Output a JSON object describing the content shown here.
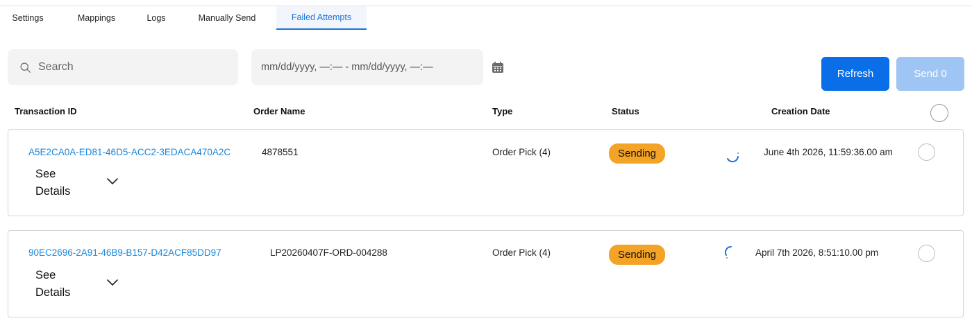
{
  "tabs": [
    {
      "label": "Settings"
    },
    {
      "label": "Mappings"
    },
    {
      "label": "Logs"
    },
    {
      "label": "Manually Send"
    },
    {
      "label": "Failed Attempts",
      "active": true
    }
  ],
  "search": {
    "placeholder": "Search",
    "icon": "search-icon"
  },
  "date_range": {
    "text": "mm/dd/yyyy, —:—  - mm/dd/yyyy, —:—",
    "icon": "calendar-icon"
  },
  "buttons": {
    "refresh": "Refresh",
    "send": "Send 0"
  },
  "table": {
    "headers": {
      "transaction_id": "Transaction ID",
      "order_name": "Order Name",
      "type": "Type",
      "status": "Status",
      "creation_date": "Creation Date"
    },
    "rows": [
      {
        "transaction_id": "A5E2CA0A-ED81-46D5-ACC2-3EDACA470A2C",
        "see_details_1": "See",
        "see_details_2": "Details",
        "order_name": "4878551",
        "type": "Order Pick (4)",
        "status": "Sending",
        "creation_date": "June 4th 2026, 11:59:36.00 am"
      },
      {
        "transaction_id": "90EC2696-2A91-46B9-B157-D42ACF85DD97",
        "see_details_1": "See",
        "see_details_2": "Details",
        "order_name": "LP20260407F-ORD-004288",
        "type": "Order Pick (4)",
        "status": "Sending",
        "creation_date": "April 7th 2026, 8:51:10.00 pm"
      }
    ]
  },
  "colors": {
    "accent": "#1a73d9",
    "link": "#1a86d9",
    "refresh_button": "#0a6ee8",
    "send_button_disabled": "#9ec5f3",
    "status_sending": "#f3a325"
  }
}
